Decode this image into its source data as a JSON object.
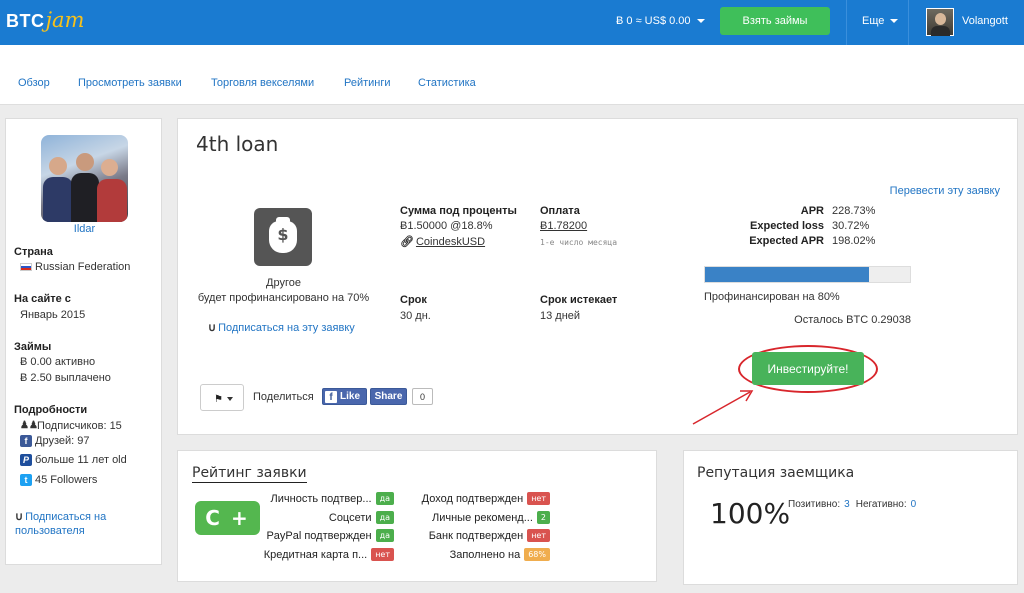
{
  "topbar": {
    "logo_btc": "BTC",
    "logo_jam": "jam",
    "balance": "Ƀ 0 ≈ US$ 0.00",
    "loan_button": "Взять займы",
    "more_menu": "Еще",
    "username": "Volangott"
  },
  "subnav": {
    "items": [
      "Обзор",
      "Просмотреть заявки",
      "Торговля векселями",
      "Рейтинги",
      "Статистика"
    ]
  },
  "profile": {
    "name": "Ildar",
    "country_label": "Страна",
    "country": "Russian Federation",
    "since_label": "На сайте с",
    "since": "Январь 2015",
    "loans_label": "Займы",
    "loans_active": "Ƀ 0.00 активно",
    "loans_repaid": "Ƀ 2.50 выплачено",
    "details_label": "Подробности",
    "followers": "Подписчиков: 15",
    "fb_friends": "Друзей: 97",
    "paypal": "больше 11 лет old",
    "twitter": "45 Followers",
    "subscribe_line1": "Подписаться на",
    "subscribe_line2": "пользователя"
  },
  "loan": {
    "title": "4th loan",
    "translate_link": "Перевести эту заявку",
    "category": "Другое",
    "funded_note": "будет профинансировано на 70%",
    "subscribe": "Подписаться на эту заявку",
    "amount_label": "Сумма под проценты",
    "amount_value": "Ƀ1.50000 @18.8%",
    "amount_source": "CoindeskUSD",
    "payment_label": "Оплата",
    "payment_value": "Ƀ1.78200",
    "payment_schedule": "1-е число месяца",
    "term_label": "Срок",
    "term_value": "30 дн.",
    "expires_label": "Срок истекает",
    "expires_value": "13 дней",
    "apr_label": "APR",
    "apr_value": "228.73%",
    "eloss_label": "Expected loss",
    "eloss_value": "30.72%",
    "eapr_label": "Expected APR",
    "eapr_value": "198.02%",
    "funded_fraction": 0.8,
    "funded_text": "Профинансирован на 80%",
    "remaining": "Осталось BTC 0.29038",
    "invest_button": "Инвестируйте!",
    "share_label": "Поделиться",
    "fb_like": "Like",
    "fb_share": "Share",
    "share_count": "0"
  },
  "rating": {
    "title": "Рейтинг заявки",
    "grade": "C +",
    "items_left": [
      {
        "label": "Личность подтвер...",
        "badge": "да",
        "kind": "yes"
      },
      {
        "label": "Соцсети",
        "badge": "да",
        "kind": "yes"
      },
      {
        "label": "PayPal подтвержден",
        "badge": "да",
        "kind": "yes"
      },
      {
        "label": "Кредитная карта п...",
        "badge": "нет",
        "kind": "no"
      }
    ],
    "items_right": [
      {
        "label": "Доход подтвержден",
        "badge": "нет",
        "kind": "no"
      },
      {
        "label": "Личные рекоменд...",
        "badge": "2",
        "kind": "num"
      },
      {
        "label": "Банк подтвержден",
        "badge": "нет",
        "kind": "no"
      },
      {
        "label": "Заполнено на",
        "badge": "68%",
        "kind": "warn"
      }
    ]
  },
  "reputation": {
    "title": "Репутация заемщика",
    "percent": "100%",
    "positive_label": "Позитивно:",
    "positive": "3",
    "negative_label": "Негативно:",
    "negative": "0"
  },
  "colors": {
    "brand_blue": "#1a7bd1",
    "accent_green": "#3fbf5a",
    "link_blue": "#2275c4",
    "highlight_red": "#d8262c"
  }
}
